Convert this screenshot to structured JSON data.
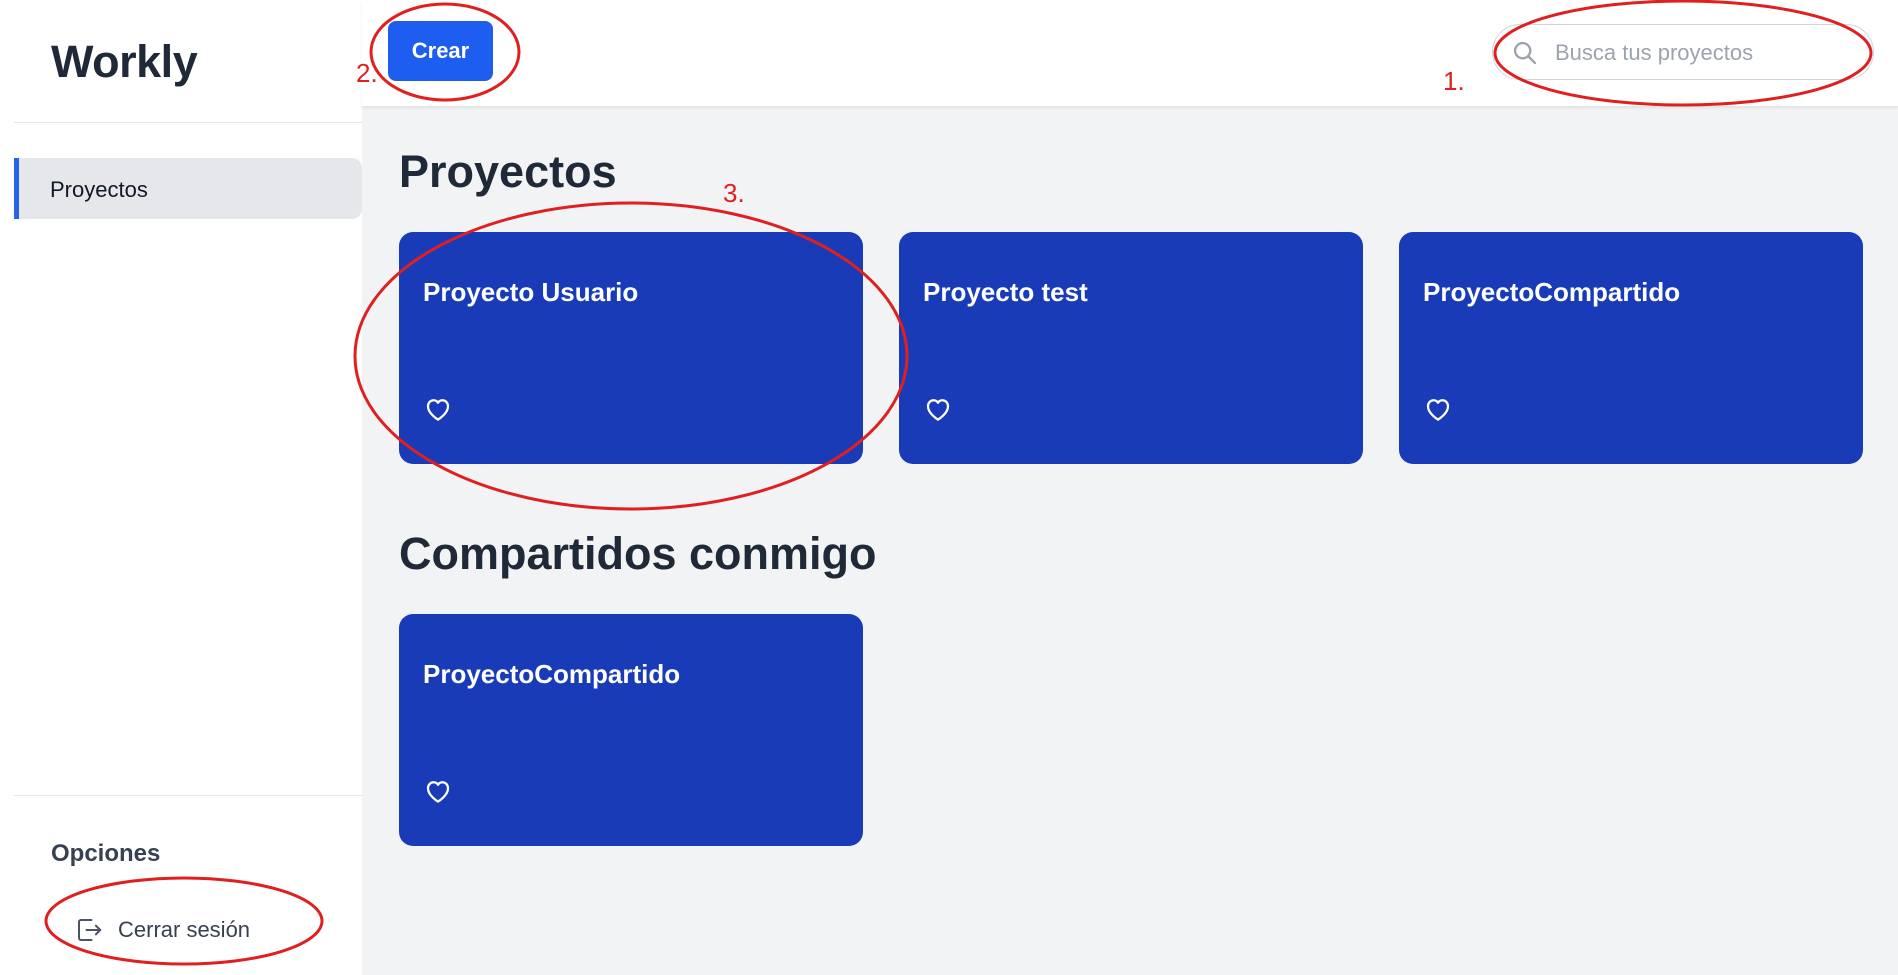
{
  "app": {
    "name": "Workly"
  },
  "sidebar": {
    "nav_items": [
      {
        "label": "Proyectos",
        "active": true
      }
    ],
    "options_title": "Opciones",
    "logout_label": "Cerrar sesión"
  },
  "topbar": {
    "create_label": "Crear",
    "search": {
      "placeholder": "Busca tus proyectos",
      "value": ""
    }
  },
  "sections": {
    "my_projects": {
      "title": "Proyectos",
      "cards": [
        {
          "title": "Proyecto Usuario",
          "favorite": false
        },
        {
          "title": "Proyecto test",
          "favorite": false
        },
        {
          "title": "ProyectoCompartido",
          "favorite": false
        }
      ]
    },
    "shared": {
      "title": "Compartidos conmigo",
      "cards": [
        {
          "title": "ProyectoCompartido",
          "favorite": false
        }
      ]
    }
  },
  "annotations": {
    "labels": [
      "1.",
      "2.",
      "3."
    ],
    "color": "#e02020"
  },
  "colors": {
    "primary": "#1d5ef0",
    "card": "#1a3bb8",
    "background": "#f2f3f5"
  },
  "icons": {
    "search": "search-icon",
    "heart": "heart-icon",
    "logout": "logout-icon"
  }
}
